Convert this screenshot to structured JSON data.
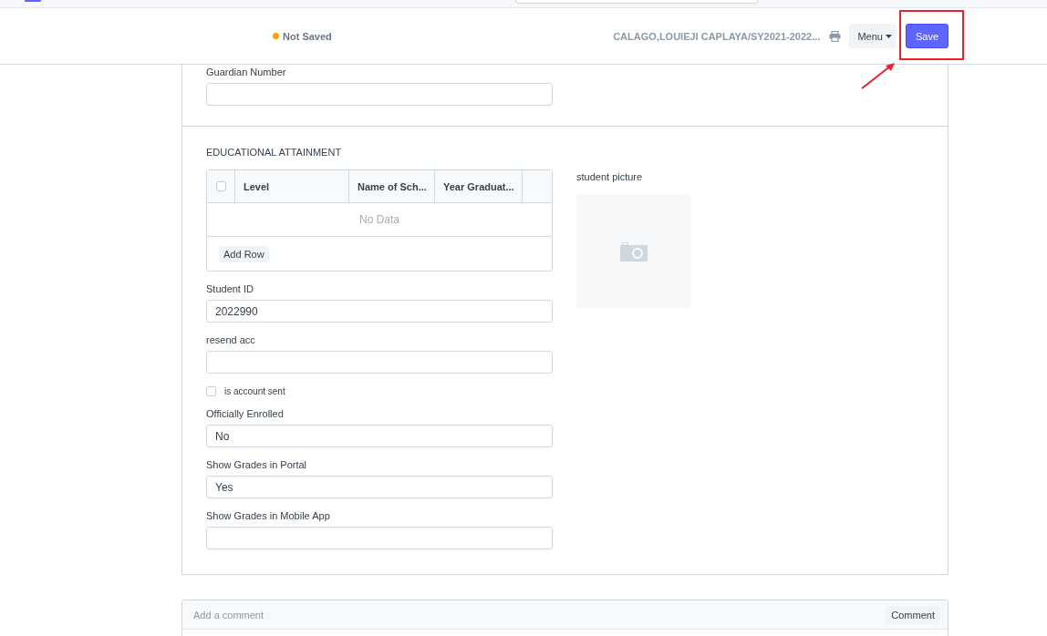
{
  "header": {
    "status": "Not Saved",
    "title": "CALAGO,LOUIEJI CAPLAYA/SY2021-2022...",
    "menu_button": "Menu",
    "save_button": "Save"
  },
  "top_fields": [
    {
      "label": "Guardian Number"
    }
  ],
  "section": {
    "title": "EDUCATIONAL ATTAINMENT",
    "table": {
      "select_all_checked": false,
      "columns": [
        "Level",
        "Name of Sch...",
        "Year Graduat..."
      ],
      "empty_text": "No Data",
      "add_row_button": "Add Row"
    },
    "fields": [
      {
        "kind": "input",
        "label": "Student ID",
        "value": "2022990"
      },
      {
        "kind": "input",
        "label": "resend acc"
      },
      {
        "kind": "checkbox",
        "label": "is account sent",
        "checked": false
      },
      {
        "kind": "select",
        "label": "Officially Enrolled",
        "value": "No"
      },
      {
        "kind": "select",
        "label": "Show Grades in Portal",
        "value": "Yes"
      },
      {
        "kind": "select",
        "label": "Show Grades in Mobile App"
      }
    ],
    "picture_field": {
      "label": "student picture"
    }
  },
  "comments": {
    "placeholder": "Add a comment",
    "button": "Comment"
  }
}
